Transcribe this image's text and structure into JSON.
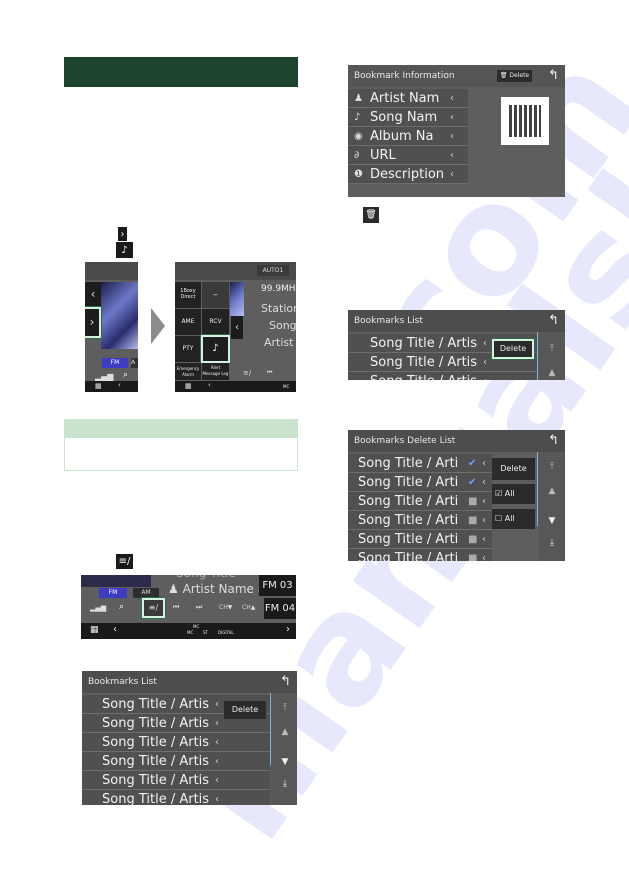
{
  "section_header": {
    "color": "#1e4430"
  },
  "inline_icons": {
    "next_arrow": "›",
    "bookmark_icon": "♪",
    "bookmark_list_icon": "≡/",
    "delete_icon": "🗑"
  },
  "radio_screen_small": {
    "prev_label": "‹",
    "next_label": "›",
    "band_fm": "FM",
    "band_am": "A",
    "menu_label": "|||",
    "nav_back": "‹"
  },
  "radio_screen_expanded": {
    "preset_button": "AUTO1",
    "buttons": [
      "1Boxy Direct",
      "–",
      "AME",
      "RCV",
      "PTY",
      "",
      "Emergency Alarm",
      "Alert Message Log"
    ],
    "info": {
      "frequency": "99.9MH",
      "station": "Station",
      "song": "Song",
      "artist": "Artist"
    },
    "status": "MC"
  },
  "tip_box": {
    "header_color": "#c9e3cc"
  },
  "radio_bar_screen": {
    "song_partial": "Song Title",
    "artist": "Artist Name",
    "bands": [
      "FM",
      "AM"
    ],
    "controls": [
      "⏮",
      "⏭",
      "CH▼",
      "CH▲"
    ],
    "presets": [
      "FM 03",
      "FM 04"
    ],
    "status": [
      "MC",
      "MC",
      "ST",
      "DIGITAL"
    ]
  },
  "bookmarks_list_main": {
    "title": "Bookmarks List",
    "delete_label": "Delete",
    "items": [
      "Song Title / Artis",
      "Song Title / Artis",
      "Song Title / Artis",
      "Song Title / Artis",
      "Song Title / Artis",
      "Song Title / Artis"
    ]
  },
  "bookmark_information": {
    "title": "Bookmark Information",
    "delete_label": "Delete",
    "fields": [
      {
        "icon": "person-icon",
        "label": "Artist Nam"
      },
      {
        "icon": "note-icon",
        "label": "Song Nam"
      },
      {
        "icon": "disc-icon",
        "label": "Album Na"
      },
      {
        "icon": "link-icon",
        "label": "URL"
      },
      {
        "icon": "info-icon",
        "label": "Description"
      }
    ]
  },
  "bookmarks_list_small": {
    "title": "Bookmarks List",
    "delete_label": "Delete",
    "items": [
      "Song Title / Artis",
      "Song Title / Artis",
      "Song Title / Artis"
    ]
  },
  "bookmarks_delete_list": {
    "title": "Bookmarks Delete List",
    "delete_label": "Delete",
    "select_all_label": "All",
    "deselect_all_label": "All",
    "items": [
      {
        "label": "Song Title / Arti",
        "checked": true
      },
      {
        "label": "Song Title / Arti",
        "checked": true
      },
      {
        "label": "Song Title / Arti",
        "checked": false
      },
      {
        "label": "Song Title / Arti",
        "checked": false
      },
      {
        "label": "Song Title / Arti",
        "checked": false
      },
      {
        "label": "Song Title / Arti",
        "checked": false
      }
    ]
  }
}
